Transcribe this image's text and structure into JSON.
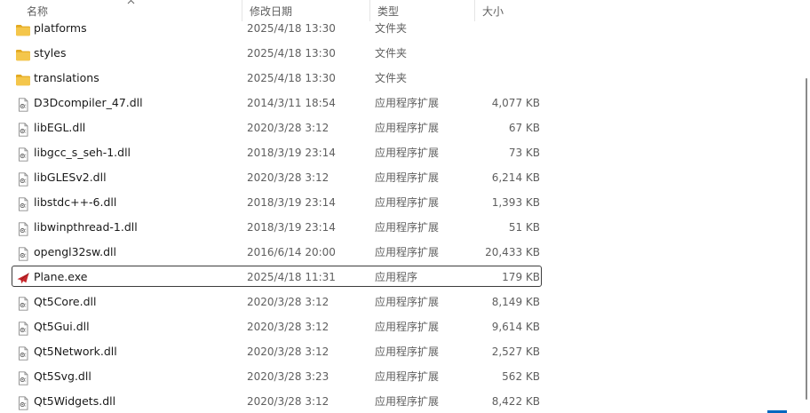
{
  "columns": {
    "name": "名称",
    "date": "修改日期",
    "type": "类型",
    "size": "大小"
  },
  "files": [
    {
      "name": "platforms",
      "date": "2025/4/18 13:30",
      "type": "文件夹",
      "size": "",
      "icon": "folder-icon"
    },
    {
      "name": "styles",
      "date": "2025/4/18 13:30",
      "type": "文件夹",
      "size": "",
      "icon": "folder-icon"
    },
    {
      "name": "translations",
      "date": "2025/4/18 13:30",
      "type": "文件夹",
      "size": "",
      "icon": "folder-icon"
    },
    {
      "name": "D3Dcompiler_47.dll",
      "date": "2014/3/11 18:54",
      "type": "应用程序扩展",
      "size": "4,077 KB",
      "icon": "dll-file-icon"
    },
    {
      "name": "libEGL.dll",
      "date": "2020/3/28 3:12",
      "type": "应用程序扩展",
      "size": "67 KB",
      "icon": "dll-file-icon"
    },
    {
      "name": "libgcc_s_seh-1.dll",
      "date": "2018/3/19 23:14",
      "type": "应用程序扩展",
      "size": "73 KB",
      "icon": "dll-file-icon"
    },
    {
      "name": "libGLESv2.dll",
      "date": "2020/3/28 3:12",
      "type": "应用程序扩展",
      "size": "6,214 KB",
      "icon": "dll-file-icon"
    },
    {
      "name": "libstdc++-6.dll",
      "date": "2018/3/19 23:14",
      "type": "应用程序扩展",
      "size": "1,393 KB",
      "icon": "dll-file-icon"
    },
    {
      "name": "libwinpthread-1.dll",
      "date": "2018/3/19 23:14",
      "type": "应用程序扩展",
      "size": "51 KB",
      "icon": "dll-file-icon"
    },
    {
      "name": "opengl32sw.dll",
      "date": "2016/6/14 20:00",
      "type": "应用程序扩展",
      "size": "20,433 KB",
      "icon": "dll-file-icon"
    },
    {
      "name": "Plane.exe",
      "date": "2025/4/18 11:31",
      "type": "应用程序",
      "size": "179 KB",
      "icon": "plane-app-icon",
      "selected": true
    },
    {
      "name": "Qt5Core.dll",
      "date": "2020/3/28 3:12",
      "type": "应用程序扩展",
      "size": "8,149 KB",
      "icon": "dll-file-icon"
    },
    {
      "name": "Qt5Gui.dll",
      "date": "2020/3/28 3:12",
      "type": "应用程序扩展",
      "size": "9,614 KB",
      "icon": "dll-file-icon"
    },
    {
      "name": "Qt5Network.dll",
      "date": "2020/3/28 3:12",
      "type": "应用程序扩展",
      "size": "2,527 KB",
      "icon": "dll-file-icon"
    },
    {
      "name": "Qt5Svg.dll",
      "date": "2020/3/28 3:23",
      "type": "应用程序扩展",
      "size": "562 KB",
      "icon": "dll-file-icon"
    },
    {
      "name": "Qt5Widgets.dll",
      "date": "2020/3/28 3:12",
      "type": "应用程序扩展",
      "size": "8,422 KB",
      "icon": "dll-file-icon"
    }
  ],
  "colors": {
    "folder": "#f4c64b",
    "folder_dark": "#e3a921",
    "selection_border": "#3c3c3c",
    "plane_icon": "#c8282d",
    "accent": "#0067c0"
  }
}
